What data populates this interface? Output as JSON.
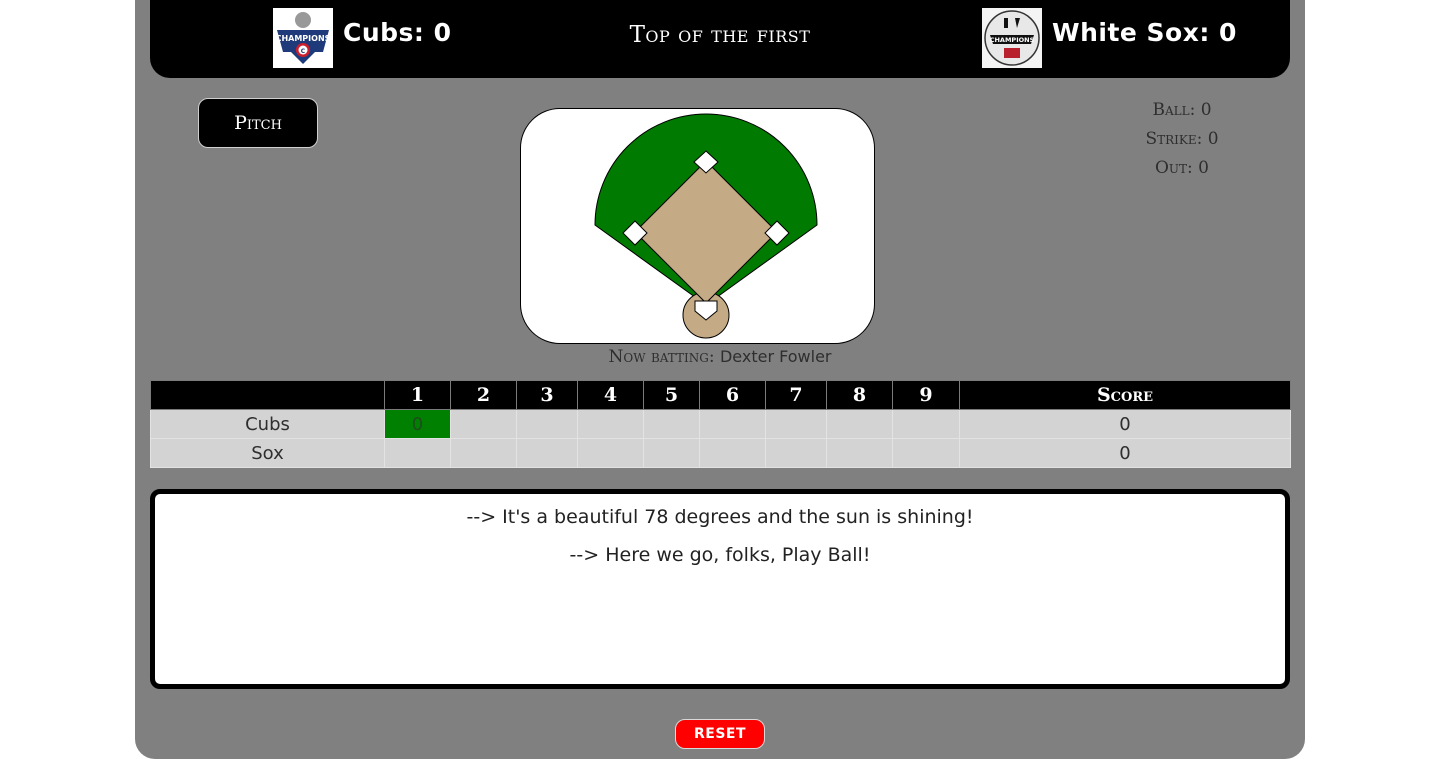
{
  "header": {
    "home_team_score_text": "Cubs: 0",
    "inning_title": "Top of the first",
    "away_team_score_text": "White Sox: 0",
    "cubs_logo_text": "CHAMPIONS",
    "cubs_logo_badge": "C",
    "sox_logo_text": "CHAMPIONS"
  },
  "controls": {
    "pitch_label": "Pitch",
    "reset_label": "RESET"
  },
  "count": {
    "ball": "Ball: 0",
    "strike": "Strike: 0",
    "out": "Out: 0"
  },
  "now_batting": {
    "label": "Now batting:",
    "batter": "Dexter Fowler"
  },
  "linescore": {
    "headers": [
      "",
      "1",
      "2",
      "3",
      "4",
      "5",
      "6",
      "7",
      "8",
      "9",
      "Score"
    ],
    "rows": [
      {
        "team": "Cubs",
        "innings": [
          "0",
          "",
          "",
          "",
          "",
          "",
          "",
          "",
          ""
        ],
        "score": "0"
      },
      {
        "team": "Sox",
        "innings": [
          "",
          "",
          "",
          "",
          "",
          "",
          "",
          "",
          ""
        ],
        "score": "0"
      }
    ]
  },
  "commentary": [
    "--> It's a beautiful 78 degrees and the sun is shining!",
    "--> Here we go, folks, Play Ball!"
  ],
  "colors": {
    "outfield": "#007a00",
    "infield_dirt": "#c4aa85",
    "current_inning": "#008000",
    "reset": "#ff0000",
    "frame": "#808080"
  }
}
